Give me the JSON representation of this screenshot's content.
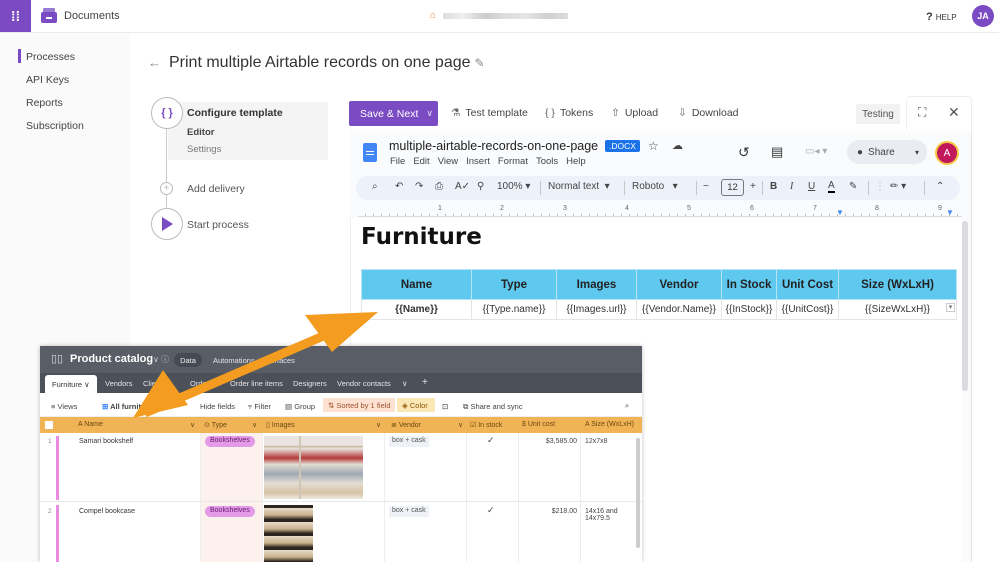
{
  "topbar": {
    "app_name": "Documents",
    "help_label": "HELP",
    "user_initials": "JA"
  },
  "sidebar": {
    "items": [
      {
        "label": "Processes",
        "active": true
      },
      {
        "label": "API Keys",
        "active": false
      },
      {
        "label": "Reports",
        "active": false
      },
      {
        "label": "Subscription",
        "active": false
      }
    ]
  },
  "page": {
    "title": "Print multiple Airtable records on one page"
  },
  "steps": {
    "configure": {
      "label": "Configure template",
      "sub_items": [
        "Editor",
        "Settings"
      ]
    },
    "delivery": {
      "label": "Add delivery"
    },
    "start": {
      "label": "Start process"
    }
  },
  "toolbar": {
    "save_next": "Save & Next",
    "test_template": "Test template",
    "tokens": "Tokens",
    "upload": "Upload",
    "download": "Download",
    "testing": "Testing"
  },
  "gdoc": {
    "filename": "multiple-airtable-records-on-one-page",
    "badge": ".DOCX",
    "menu": [
      "File",
      "Edit",
      "View",
      "Insert",
      "Format",
      "Tools",
      "Help"
    ],
    "share_label": "Share",
    "user_initial": "A",
    "zoom": "100%",
    "style": "Normal text",
    "font": "Roboto",
    "font_size": "12",
    "ruler_numbers": [
      "1",
      "2",
      "3",
      "4",
      "5",
      "6",
      "7",
      "8",
      "9"
    ],
    "heading": "Furniture",
    "table": {
      "headers": [
        "Name",
        "Type",
        "Images",
        "Vendor",
        "In Stock",
        "Unit Cost",
        "Size (WxLxH)"
      ],
      "row": [
        "{{Name}}",
        "{{Type.name}}",
        "{{Images.url}}",
        "{{Vendor.Name}}",
        "{{InStock}}",
        "{{UnitCost}}",
        "{{SizeWxLxH}}"
      ]
    }
  },
  "airtable": {
    "base_name": "Product catalog",
    "nav": [
      "Data",
      "Automations",
      "Interfaces"
    ],
    "tabs": [
      "Furniture",
      "Vendors",
      "Clients",
      "Orders",
      "Order line items",
      "Designers",
      "Vendor contacts"
    ],
    "viewbar": {
      "views": "Views",
      "view_name": "All furniture",
      "hide_fields": "Hide fields",
      "filter": "Filter",
      "group": "Group",
      "sorted": "Sorted by 1 field",
      "color": "Color",
      "share": "Share and sync"
    },
    "columns": [
      "Name",
      "Type",
      "Images",
      "Vendor",
      "In stock",
      "Unit cost",
      "Size (WxLxH)"
    ],
    "rows": [
      {
        "num": "1",
        "name": "Samari bookshelf",
        "type": "Bookshelves",
        "vendor": "box + cask",
        "in_stock": "✓",
        "unit_cost": "$3,585.00",
        "size": "12x7x8"
      },
      {
        "num": "2",
        "name": "Compel bookcase",
        "type": "Bookshelves",
        "vendor": "box + cask",
        "in_stock": "✓",
        "unit_cost": "$218.00",
        "size": "14x16 and 14x79.5"
      }
    ]
  },
  "colors": {
    "brand": "#7b4bc4",
    "table_header": "#5ec8ef",
    "airtable_header": "#f0b355",
    "arrow": "#f39c1f"
  }
}
